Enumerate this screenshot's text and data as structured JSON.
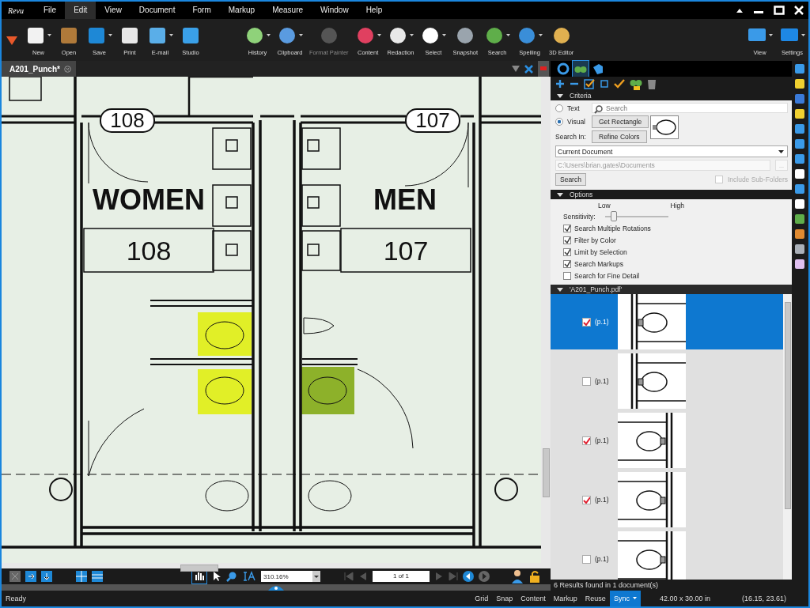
{
  "menu": {
    "logo": "Revu",
    "items": [
      {
        "label": "File",
        "selected": false
      },
      {
        "label": "Edit",
        "selected": true
      },
      {
        "label": "View",
        "selected": false
      },
      {
        "label": "Document",
        "selected": false
      },
      {
        "label": "Form",
        "selected": false
      },
      {
        "label": "Markup",
        "selected": false
      },
      {
        "label": "Measure",
        "selected": false
      },
      {
        "label": "Window",
        "selected": false
      },
      {
        "label": "Help",
        "selected": false
      }
    ]
  },
  "toolbar": {
    "left": [
      {
        "label": "New",
        "menu": true,
        "disabled": false
      },
      {
        "label": "Open",
        "menu": false,
        "disabled": false
      },
      {
        "label": "Save",
        "menu": true,
        "disabled": false
      },
      {
        "label": "Print",
        "menu": false,
        "disabled": false
      },
      {
        "label": "E-mail",
        "menu": true,
        "disabled": false
      },
      {
        "label": "Studio",
        "menu": false,
        "disabled": false
      }
    ],
    "middle": [
      {
        "label": "History",
        "menu": true,
        "disabled": false
      },
      {
        "label": "Clipboard",
        "menu": true,
        "disabled": false
      },
      {
        "label": "Format Painter",
        "menu": false,
        "disabled": true
      },
      {
        "label": "Content",
        "menu": true,
        "disabled": false
      },
      {
        "label": "Redaction",
        "menu": true,
        "disabled": false
      },
      {
        "label": "Select",
        "menu": true,
        "disabled": false
      },
      {
        "label": "Snapshot",
        "menu": false,
        "disabled": false
      },
      {
        "label": "Search",
        "menu": true,
        "disabled": false
      },
      {
        "label": "Spelling",
        "menu": true,
        "disabled": false
      },
      {
        "label": "3D Editor",
        "menu": false,
        "disabled": false
      }
    ],
    "right": [
      {
        "label": "View",
        "menu": true,
        "disabled": false
      },
      {
        "label": "Settings",
        "menu": true,
        "disabled": false
      }
    ]
  },
  "document_tab": {
    "title": "A201_Punch*",
    "selected": true
  },
  "plan": {
    "rooms": [
      {
        "tag": "108",
        "name": "WOMEN",
        "number": "108"
      },
      {
        "tag": "107",
        "name": "MEN",
        "number": "107"
      }
    ],
    "highlights": [
      {
        "color": "#e1ef27"
      },
      {
        "color": "#e1ef27"
      },
      {
        "color": "#8db12a"
      }
    ]
  },
  "nav": {
    "zoom": "310.16%",
    "page": "1 of 1"
  },
  "panel_tabs": [
    {
      "selected": false
    },
    {
      "selected": true
    },
    {
      "selected": false
    }
  ],
  "criteria": {
    "title": "Criteria",
    "modes": [
      {
        "label": "Text",
        "selected": false
      },
      {
        "label": "Visual",
        "selected": true
      }
    ],
    "search_placeholder": "Search",
    "buttons": [
      "Get Rectangle",
      "Refine Colors"
    ],
    "search_in_label": "Search In:",
    "scope": "Current Document",
    "path": "C:\\Users\\brian.gates\\Documents",
    "browse": "...",
    "search_button": "Search",
    "include_subfolders": {
      "label": "Include Sub-Folders",
      "checked": false,
      "disabled": true
    }
  },
  "options": {
    "title": "Options",
    "low": "Low",
    "high": "High",
    "sensitivity_label": "Sensitivity:",
    "sensitivity": {
      "level": 0.12
    },
    "checks": [
      {
        "label": "Search Multiple Rotations",
        "checked": true
      },
      {
        "label": "Filter by Color",
        "checked": true
      },
      {
        "label": "Limit by Selection",
        "checked": true
      },
      {
        "label": "Search Markups",
        "checked": true
      },
      {
        "label": "Search for Fine Detail",
        "checked": false
      }
    ]
  },
  "results": {
    "file": "'A201_Punch.pdf'",
    "items": [
      {
        "page": "(p.1)",
        "checked": true,
        "selected": true
      },
      {
        "page": "(p.1)",
        "checked": false,
        "selected": false
      },
      {
        "page": "(p.1)",
        "checked": true,
        "selected": false
      },
      {
        "page": "(p.1)",
        "checked": true,
        "selected": false
      },
      {
        "page": "(p.1)",
        "checked": false,
        "selected": false
      }
    ],
    "summary": "6 Results found in 1 document(s)"
  },
  "status": {
    "text": "Ready",
    "toggles": [
      {
        "label": "Grid",
        "selected": false
      },
      {
        "label": "Snap",
        "selected": false
      },
      {
        "label": "Content",
        "selected": false
      },
      {
        "label": "Markup",
        "selected": false
      },
      {
        "label": "Reuse",
        "selected": false
      },
      {
        "label": "Sync",
        "selected": true
      }
    ],
    "size": "42.00 x 30.00 in",
    "coords": "(16.15, 23.61)"
  }
}
